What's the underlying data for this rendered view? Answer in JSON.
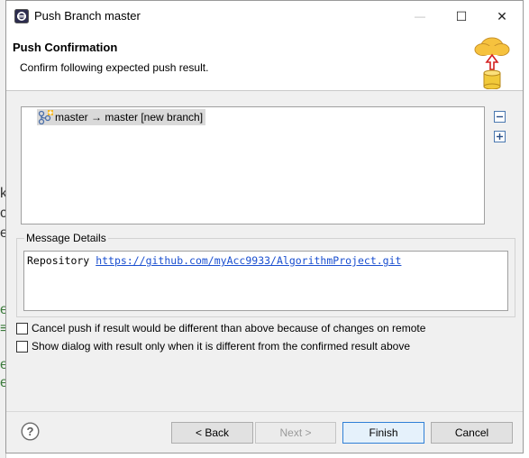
{
  "window": {
    "title": "Push Branch master",
    "buttons": {
      "minimize": "—",
      "maximize": "☐",
      "close": "✕"
    }
  },
  "banner": {
    "title": "Push Confirmation",
    "description": "Confirm following expected push result."
  },
  "tree": {
    "rows": [
      {
        "label": "master → master [new branch]",
        "icon": "new-branch-push-icon"
      }
    ],
    "collapse_icon": "collapse-all-icon",
    "expand_icon": "expand-all-icon"
  },
  "message_details": {
    "label": "Message Details",
    "prefix": "Repository",
    "url": "https://github.com/myAcc9933/AlgorithmProject.git"
  },
  "options": {
    "cancel_push": {
      "label": "Cancel push if result would be different than above because of changes on remote",
      "checked": false
    },
    "show_dialog": {
      "label": "Show dialog with result only when it is different from the confirmed result above",
      "checked": false
    }
  },
  "footer": {
    "back": "< Back",
    "next": "Next >",
    "finish": "Finish",
    "cancel": "Cancel",
    "next_enabled": false
  },
  "colors": {
    "link": "#1a4fd0",
    "cloud": "#f6c23e",
    "arrow": "#d42020",
    "focus_border": "#2f7fd6"
  }
}
